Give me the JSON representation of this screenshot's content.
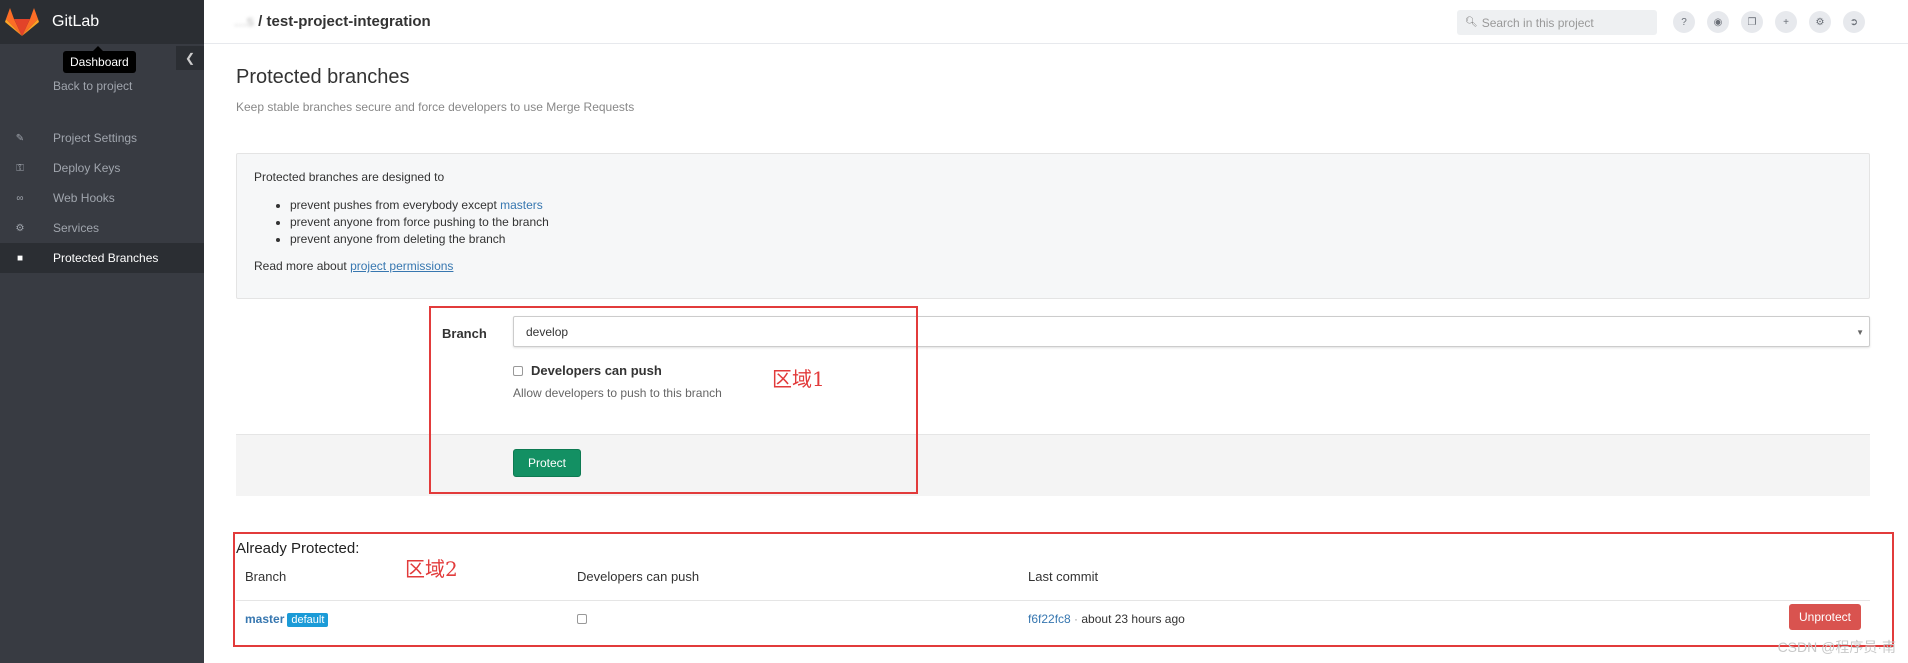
{
  "sidebar": {
    "brand": "GitLab",
    "tooltip": "Dashboard",
    "collapse_icon": "chevron-left-icon",
    "back_link": "Back to project",
    "items": [
      {
        "label": "Project Settings",
        "icon": "edit-icon"
      },
      {
        "label": "Deploy Keys",
        "icon": "key-icon"
      },
      {
        "label": "Web Hooks",
        "icon": "link-icon"
      },
      {
        "label": "Services",
        "icon": "cogs-icon"
      },
      {
        "label": "Protected Branches",
        "icon": "lock-icon",
        "active": true
      }
    ]
  },
  "header": {
    "breadcrumb_namespace": "...s",
    "breadcrumb_separator": " / ",
    "project_name": "test-project-integration",
    "search_placeholder": "Search in this project",
    "icons": [
      "question-icon",
      "globe-icon",
      "copy-icon",
      "plus-icon",
      "gear-icon",
      "sign-out-icon"
    ]
  },
  "page": {
    "title": "Protected branches",
    "subtitle": "Keep stable branches secure and force developers to use Merge Requests"
  },
  "info": {
    "intro": "Protected branches are designed to",
    "bullets": {
      "b1_prefix": "prevent pushes from everybody except ",
      "b1_link": "masters",
      "b2": "prevent anyone from force pushing to the branch",
      "b3": "prevent anyone from deleting the branch"
    },
    "read_more_prefix": "Read more about ",
    "read_more_link": "project permissions"
  },
  "form": {
    "branch_label": "Branch",
    "branch_value": "develop",
    "dev_push_label": "Developers can push",
    "dev_push_help": "Allow developers to push to this branch",
    "protect_button": "Protect"
  },
  "protected": {
    "heading": "Already Protected:",
    "columns": [
      "Branch",
      "Developers can push",
      "Last commit"
    ],
    "rows": [
      {
        "branch": "master",
        "badge": "default",
        "dev_push": false,
        "commit_sha": "f6f22fc8",
        "commit_sep": " · ",
        "commit_time": "about 23 hours ago",
        "action": "Unprotect"
      }
    ]
  },
  "annotations": {
    "region1": "区域1",
    "region2": "区域2"
  },
  "watermark": "CSDN @程序员·南",
  "colors": {
    "sidebar_bg": "#383b42",
    "primary_green": "#139063",
    "danger_red": "#d9534f",
    "link_blue": "#3777b0",
    "annotation_red": "#e23b3b"
  }
}
